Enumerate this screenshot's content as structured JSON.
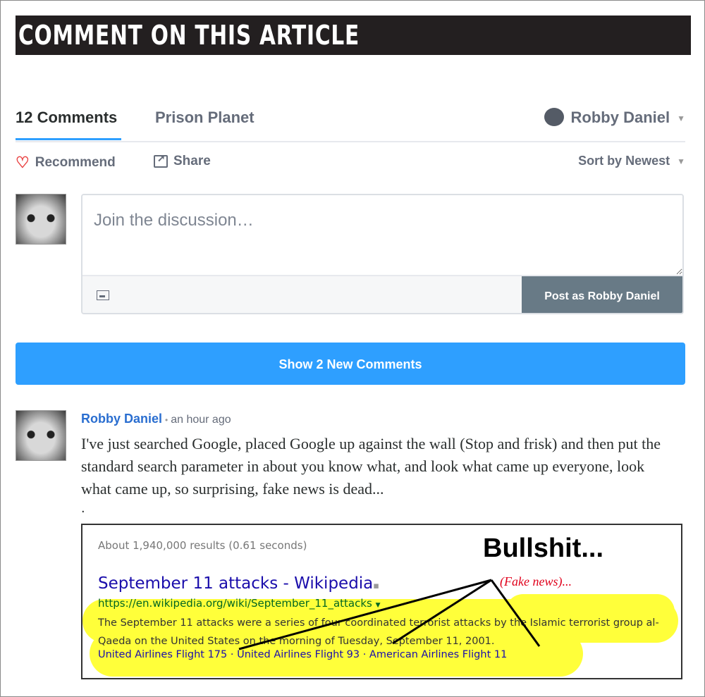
{
  "banner": {
    "title": "COMMENT ON THIS ARTICLE"
  },
  "tabs": {
    "comments": "12 Comments",
    "site": "Prison Planet",
    "user": "Robby Daniel"
  },
  "actions": {
    "recommend": "Recommend",
    "share": "Share",
    "sort": "Sort by Newest"
  },
  "composer": {
    "placeholder": "Join the discussion…",
    "post_label": "Post as Robby Daniel"
  },
  "show_new": "Show 2 New Comments",
  "comment": {
    "author": "Robby Daniel",
    "time": "an hour ago",
    "body": "I've just searched Google, placed Google up against the wall (Stop and frisk) and then put the standard search parameter in about you know what, and look what came up everyone, look what came up, so surprising, fake news is dead...",
    "trailing": "."
  },
  "embed": {
    "stats": "About 1,940,000 results (0.61 seconds)",
    "result_title": "September 11 attacks - Wikipedia",
    "result_url": "https://en.wikipedia.org/wiki/September_11_attacks",
    "snippet": "The September 11 attacks were a series of four coordinated terrorist attacks by the Islamic terrorist group al-Qaeda on the United States on the morning of Tuesday, September 11, 2001.",
    "links": "United Airlines Flight 175 · United Airlines Flight 93 · American Airlines Flight 11",
    "annotation_big": "Bullshit...",
    "annotation_small": "(Fake news)...",
    "highlight_color": "#ffff3a"
  },
  "colors": {
    "accent": "#2e9fff",
    "link": "#2a6ed0",
    "banner": "#231f20",
    "post_button": "#687a86",
    "heart": "#e94141"
  }
}
